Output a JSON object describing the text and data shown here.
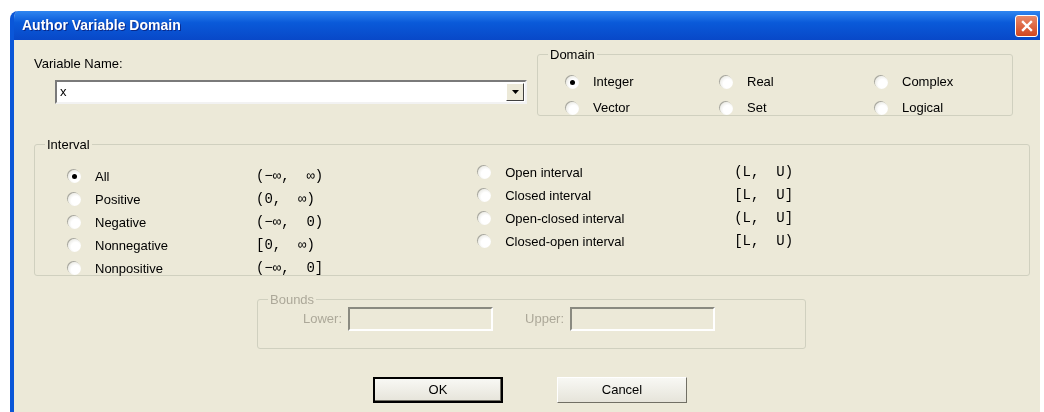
{
  "window": {
    "title": "Author Variable Domain"
  },
  "variable_name": {
    "label": "Variable Name:",
    "value": "x"
  },
  "domain": {
    "title": "Domain",
    "options": [
      {
        "label": "Integer",
        "selected": true
      },
      {
        "label": "Real",
        "selected": false
      },
      {
        "label": "Complex",
        "selected": false
      },
      {
        "label": "Vector",
        "selected": false
      },
      {
        "label": "Set",
        "selected": false
      },
      {
        "label": "Logical",
        "selected": false
      }
    ]
  },
  "interval": {
    "title": "Interval",
    "unbounded_options": [
      {
        "label": "All",
        "notation": "(−∞,  ∞)",
        "selected": true
      },
      {
        "label": "Positive",
        "notation": "(0,  ∞)",
        "selected": false
      },
      {
        "label": "Negative",
        "notation": "(−∞,  0)",
        "selected": false
      },
      {
        "label": "Nonnegative",
        "notation": "[0,  ∞)",
        "selected": false
      },
      {
        "label": "Nonpositive",
        "notation": "(−∞,  0]",
        "selected": false
      }
    ],
    "bounded_options": [
      {
        "label": "Open interval",
        "notation": "(L,  U)",
        "selected": false
      },
      {
        "label": "Closed interval",
        "notation": "[L,  U]",
        "selected": false
      },
      {
        "label": "Open-closed interval",
        "notation": "(L,  U]",
        "selected": false
      },
      {
        "label": "Closed-open interval",
        "notation": "[L,  U)",
        "selected": false
      }
    ]
  },
  "bounds": {
    "title": "Bounds",
    "disabled": true,
    "lower_label": "Lower:",
    "upper_label": "Upper:"
  },
  "buttons": [
    {
      "label": "OK",
      "default": true
    },
    {
      "label": "Cancel",
      "default": false
    }
  ]
}
